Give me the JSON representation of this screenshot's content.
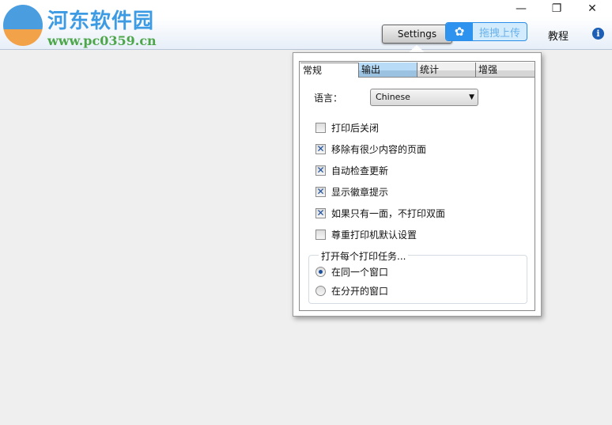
{
  "logo": {
    "title": "河东软件园",
    "url": "www.pc0359.cn"
  },
  "window": {
    "minimize": "—",
    "maximize": "❐",
    "close": "✕"
  },
  "toolbar": {
    "settings_label": "Settings",
    "upload_label": "拖拽上传",
    "upload_icon": "✿",
    "tutorial_label": "教程",
    "info_icon": "i"
  },
  "popup": {
    "tabs": [
      "常规",
      "输出",
      "统计",
      "增强"
    ],
    "language_label": "语言：",
    "language_value": "Chinese",
    "checkboxes": [
      {
        "label": "打印后关闭",
        "checked": false
      },
      {
        "label": "移除有很少内容的页面",
        "checked": true
      },
      {
        "label": "自动检查更新",
        "checked": true
      },
      {
        "label": "显示徽章提示",
        "checked": true
      },
      {
        "label": "如果只有一面，不打印双面",
        "checked": true
      },
      {
        "label": "尊重打印机默认设置",
        "checked": false
      }
    ],
    "group_label": "打开每个打印任务...",
    "radios": [
      {
        "label": "在同一个窗口",
        "selected": true
      },
      {
        "label": "在分开的窗口",
        "selected": false
      }
    ]
  }
}
